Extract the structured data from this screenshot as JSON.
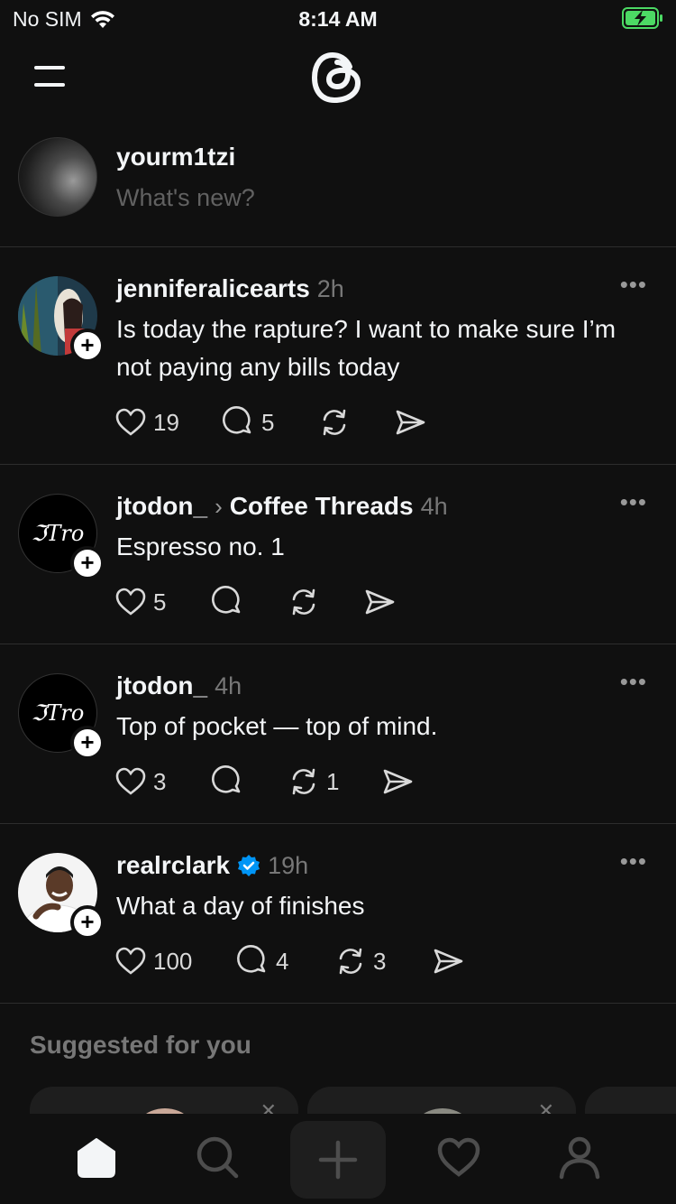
{
  "status_bar": {
    "carrier": "No SIM",
    "time": "8:14 AM"
  },
  "composer": {
    "username": "yourm1tzi",
    "placeholder": "What's new?"
  },
  "posts": [
    {
      "username": "jenniferalicearts",
      "time": "2h",
      "text": "Is today the rapture? I want to make sure I’m not paying any bills today",
      "likes": "19",
      "replies": "5",
      "reposts": ""
    },
    {
      "username": "jtodon_",
      "community": "Coffee Threads",
      "time": "4h",
      "text": "Espresso no. 1",
      "likes": "5",
      "replies": "",
      "reposts": ""
    },
    {
      "username": "jtodon_",
      "time": "4h",
      "text": "Top of pocket — top of mind.",
      "likes": "3",
      "replies": "",
      "reposts": "1"
    },
    {
      "username": "realrclark",
      "verified": true,
      "time": "19h",
      "text": "What a day of finishes",
      "likes": "100",
      "replies": "4",
      "reposts": "3"
    }
  ],
  "avatar_logo_text": "ℑTro",
  "suggested": {
    "title": "Suggested for you"
  },
  "tabbar": {
    "tabs": [
      "home-icon",
      "search-icon",
      "create-icon",
      "activity-icon",
      "profile-icon"
    ]
  },
  "colors": {
    "background": "#101010",
    "text": "#f3f5f7",
    "muted": "#777777",
    "verified": "#0095f6",
    "battery": "#4cd964"
  }
}
